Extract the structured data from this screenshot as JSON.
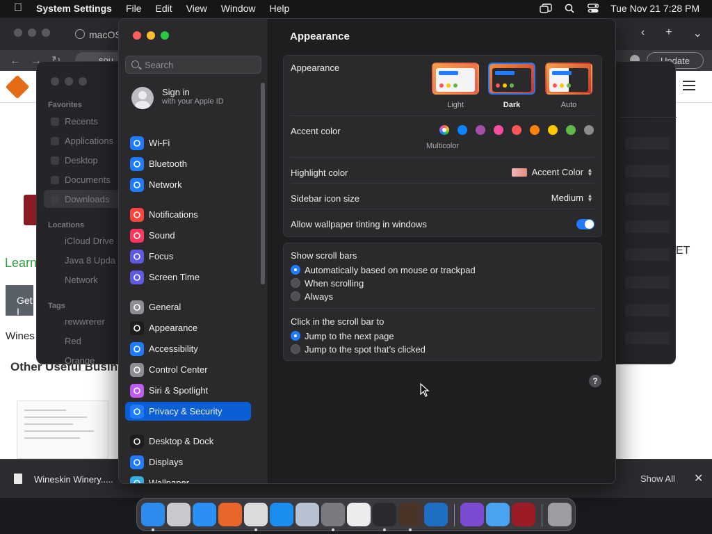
{
  "menubar": {
    "app_name": "System Settings",
    "menus": [
      "File",
      "Edit",
      "View",
      "Window",
      "Help"
    ],
    "clock": "Tue Nov 21  7:28 PM"
  },
  "browser": {
    "tab_title": "macOS",
    "url_fragment": "sou",
    "update_label": "Update",
    "learn_text": "Learn",
    "get_button": "Get I",
    "wines_text": "Wines",
    "other_text": "Other Useful Busin",
    "right_fragment": "ET"
  },
  "finder": {
    "favorites_header": "Favorites",
    "favorites": [
      "Recents",
      "Applications",
      "Desktop",
      "Documents",
      "Downloads"
    ],
    "locations_header": "Locations",
    "locations": [
      "iCloud Drive",
      "Java 8 Upda",
      "Network"
    ],
    "tags_header": "Tags",
    "tags": [
      "rewwrerer",
      "Red",
      "Orange"
    ]
  },
  "settings": {
    "search_placeholder": "Search",
    "signin_title": "Sign in",
    "signin_subtitle": "with your Apple ID",
    "sidebar": [
      {
        "label": "Wi-Fi",
        "icon": "wifi-icon",
        "color": "#1f7bff"
      },
      {
        "label": "Bluetooth",
        "icon": "bluetooth-icon",
        "color": "#1f7bff"
      },
      {
        "label": "Network",
        "icon": "globe-icon",
        "color": "#1f7bff"
      },
      {
        "label": "Notifications",
        "icon": "bell-icon",
        "color": "#ff453a"
      },
      {
        "label": "Sound",
        "icon": "speaker-icon",
        "color": "#ff375f"
      },
      {
        "label": "Focus",
        "icon": "moon-icon",
        "color": "#5e5ce6"
      },
      {
        "label": "Screen Time",
        "icon": "hourglass-icon",
        "color": "#5e5ce6"
      },
      {
        "label": "General",
        "icon": "gear-icon",
        "color": "#8e8e93"
      },
      {
        "label": "Appearance",
        "icon": "appearance-icon",
        "color": "#1c1c1e"
      },
      {
        "label": "Accessibility",
        "icon": "accessibility-icon",
        "color": "#1f7bff"
      },
      {
        "label": "Control Center",
        "icon": "control-center-icon",
        "color": "#8e8e93"
      },
      {
        "label": "Siri & Spotlight",
        "icon": "siri-icon",
        "color": "#bf5af2"
      },
      {
        "label": "Privacy & Security",
        "icon": "hand-icon",
        "color": "#1f7bff"
      },
      {
        "label": "Desktop & Dock",
        "icon": "dock-icon",
        "color": "#1c1c1e"
      },
      {
        "label": "Displays",
        "icon": "sun-icon",
        "color": "#1f7bff"
      },
      {
        "label": "Wallpaper",
        "icon": "wallpaper-icon",
        "color": "#32ade6"
      }
    ],
    "selected_item": "Privacy & Security",
    "page_title": "Appearance",
    "appearance_label": "Appearance",
    "appearance_options": [
      "Light",
      "Dark",
      "Auto"
    ],
    "appearance_selected": "Dark",
    "accent_label": "Accent color",
    "accent_colors": [
      "multicolor",
      "#0a84ff",
      "#a550a7",
      "#f74f9e",
      "#fc5753",
      "#fd8208",
      "#fdc800",
      "#62ba46",
      "#8c8c8c"
    ],
    "accent_caption": "Multicolor",
    "highlight_label": "Highlight color",
    "highlight_value": "Accent Color",
    "sidebar_icon_label": "Sidebar icon size",
    "sidebar_icon_value": "Medium",
    "wallpaper_tint_label": "Allow wallpaper tinting in windows",
    "wallpaper_tint_on": true,
    "scrollbars_label": "Show scroll bars",
    "scrollbars_options": [
      "Automatically based on mouse or trackpad",
      "When scrolling",
      "Always"
    ],
    "scrollbars_selected": 0,
    "click_label": "Click in the scroll bar to",
    "click_options": [
      "Jump to the next page",
      "Jump to the spot that’s clicked"
    ],
    "click_selected": 0,
    "help_label": "?"
  },
  "shelf": {
    "download_name": "Wineskin Winery.....",
    "show_all": "Show All",
    "close": "✕"
  },
  "dock": {
    "apps": [
      {
        "name": "finder-icon",
        "color": "#2d8cf0"
      },
      {
        "name": "launchpad-icon",
        "color": "#c9c9cf"
      },
      {
        "name": "safari-icon",
        "color": "#2b8ff5"
      },
      {
        "name": "firefox-icon",
        "color": "#e8662a"
      },
      {
        "name": "chrome-icon",
        "color": "#dcdcdc"
      },
      {
        "name": "app-store-icon",
        "color": "#1b8ef2"
      },
      {
        "name": "virtualbox-icon",
        "color": "#b6c2d2"
      },
      {
        "name": "system-settings-icon",
        "color": "#7a7a80"
      },
      {
        "name": "script-editor-icon",
        "color": "#ececec"
      },
      {
        "name": "terminal-icon",
        "color": "#2a2a2e"
      },
      {
        "name": "instruments-icon",
        "color": "#4a3428"
      },
      {
        "name": "vscode-icon",
        "color": "#1e6fc4"
      },
      {
        "name": "visual-studio-icon",
        "color": "#7b4bd1"
      },
      {
        "name": "icloud-icon",
        "color": "#4aa3f0"
      },
      {
        "name": "wineskin-icon",
        "color": "#9b1c26"
      },
      {
        "name": "trash-icon",
        "color": "#9c9ca2"
      }
    ]
  }
}
